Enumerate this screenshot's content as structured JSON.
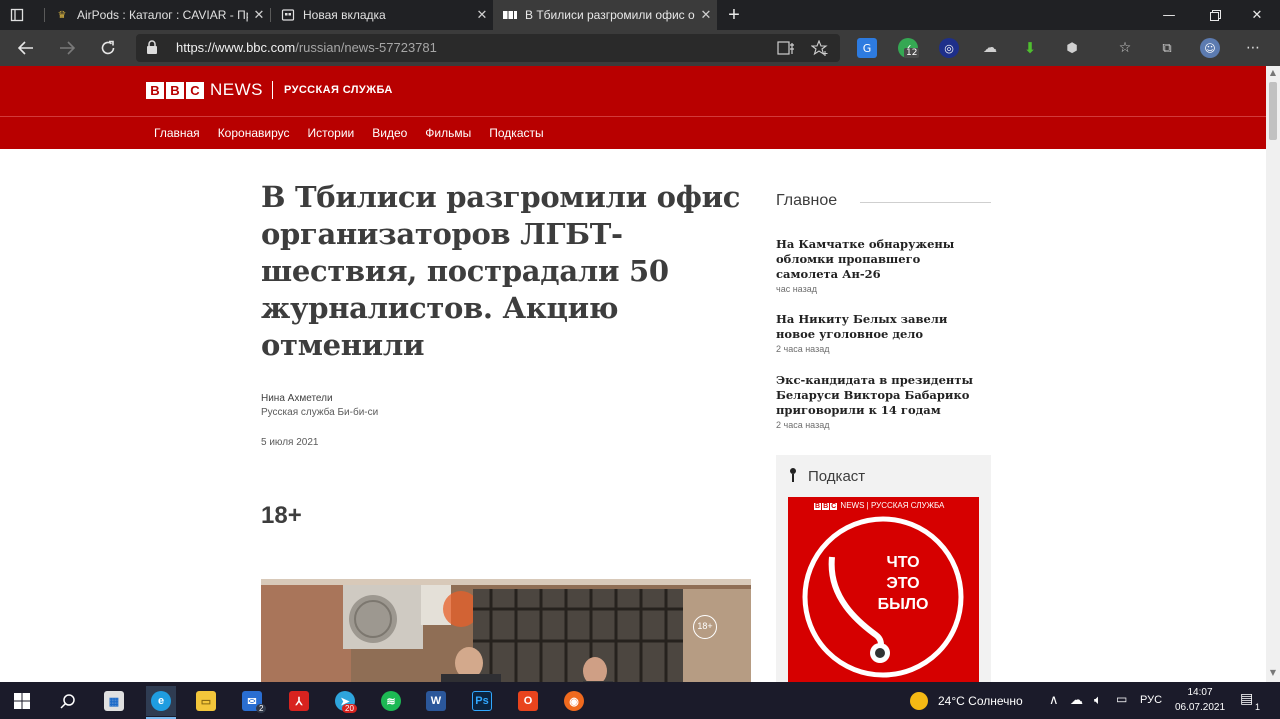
{
  "browser": {
    "tabs": [
      {
        "title": "AirPods : Каталог : CAVIAR - Пре",
        "active": false
      },
      {
        "title": "Новая вкладка",
        "active": false
      },
      {
        "title": "В Тбилиси разгромили офис ор",
        "active": true
      }
    ],
    "new_tab_label": "+",
    "url_host": "https://www.bbc.com",
    "url_path": "/russian/news-57723781",
    "extension_badge": "12"
  },
  "site": {
    "logo_letters": [
      "B",
      "B",
      "C"
    ],
    "news_label": "NEWS",
    "service_label": "РУССКАЯ СЛУЖБА",
    "nav": [
      "Главная",
      "Коронавирус",
      "Истории",
      "Видео",
      "Фильмы",
      "Подкасты"
    ]
  },
  "article": {
    "headline": "В Тбилиси разгромили офис организаторов ЛГБТ-шествия, пострадали 50 журналистов. Акцию отменили",
    "author": "Нина Ахметели",
    "organization": "Русская служба Би-би-си",
    "date": "5 июля 2021",
    "age_rating": "18+",
    "photo_age_mark": "18+"
  },
  "sidebar": {
    "title": "Главное",
    "stories": [
      {
        "title": "На Камчатке обнаружены обломки пропавшего самолета Ан-26",
        "time": "час назад"
      },
      {
        "title": "На Никиту Белых завели новое уголовное дело",
        "time": "2 часа назад"
      },
      {
        "title": "Экс-кандидата в президенты Беларуси Виктора Бабарико приговорили к 14 годам",
        "time": "2 часа назад"
      }
    ],
    "podcast_title": "Подкаст",
    "podcast_logo": "NEWS | РУССКАЯ СЛУЖБА",
    "podcast_art_text": "ЧТО ЭТО БЫЛО"
  },
  "taskbar": {
    "mail_badge": "2",
    "pdf_badge": "20",
    "photoshop_label": "Ps",
    "weather": "24°C  Солнечно",
    "language": "РУС",
    "time": "14:07",
    "date": "06.07.2021",
    "notifications": "1"
  }
}
